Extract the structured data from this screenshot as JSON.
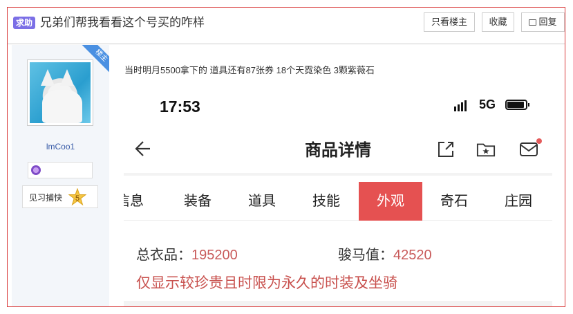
{
  "header": {
    "tag": "求助",
    "title": "兄弟们帮我看看这个号买的咋样",
    "btn_owner": "只看楼主",
    "btn_fav": "收藏",
    "btn_reply": "回复"
  },
  "sidebar": {
    "ribbon": "楼主",
    "username": "lmCoo1",
    "level_label": "见习捕快",
    "level_num": "5"
  },
  "post": {
    "text": "当时明月5500拿下的 道具还有87张券 18个天霓染色 3颗紫薇石"
  },
  "phone": {
    "time": "17:53",
    "network": "5G",
    "page_title": "商品详情",
    "tabs": [
      "信息",
      "装备",
      "道具",
      "技能",
      "外观",
      "奇石",
      "庄园"
    ],
    "active_tab": "外观",
    "stat1_label": "总衣品：",
    "stat1_value": "195200",
    "stat2_label": "骏马值：",
    "stat2_value": "42520",
    "note": "仅显示较珍贵且时限为永久的时装及坐骑"
  },
  "colors": {
    "accent": "#e55151",
    "tag": "#7b6fe6",
    "ribbon": "#4a90e2",
    "frame": "#d93a3a"
  }
}
